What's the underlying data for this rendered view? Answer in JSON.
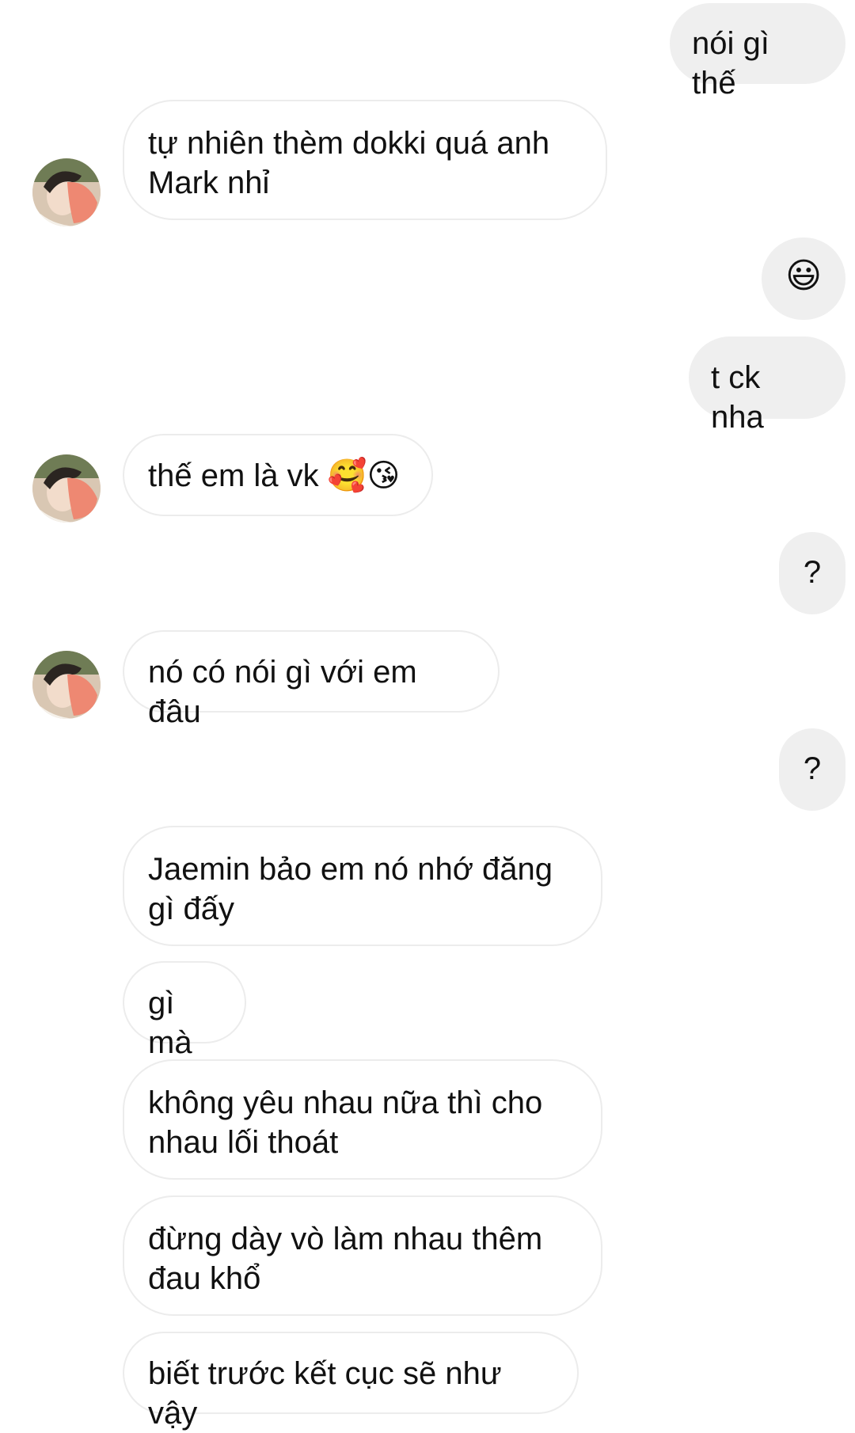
{
  "conversation": {
    "messages": [
      {
        "id": "m1",
        "sender": "me",
        "text": "nói gì thế"
      },
      {
        "id": "m2",
        "sender": "them",
        "text": "tự nhiên thèm dokki quá anh Mark nhỉ",
        "avatar": "contact-avatar"
      },
      {
        "id": "m3",
        "sender": "me",
        "text": "😃"
      },
      {
        "id": "m4",
        "sender": "me",
        "text": "t ck nha"
      },
      {
        "id": "m5",
        "sender": "them",
        "text": "thế em là vk 🥰😘",
        "avatar": "contact-avatar"
      },
      {
        "id": "m6",
        "sender": "me",
        "text": "?"
      },
      {
        "id": "m7",
        "sender": "them",
        "text": "nó có nói gì với em đâu",
        "avatar": "contact-avatar"
      },
      {
        "id": "m8",
        "sender": "me",
        "text": "?"
      },
      {
        "id": "m9",
        "sender": "them",
        "text": "Jaemin bảo em nó nhớ đăng gì đấy"
      },
      {
        "id": "m10",
        "sender": "them",
        "text": "gì mà"
      },
      {
        "id": "m11",
        "sender": "them",
        "text": "không yêu nhau nữa thì cho nhau lối thoát"
      },
      {
        "id": "m12",
        "sender": "them",
        "text": "đừng dày vò làm nhau thêm đau khổ"
      },
      {
        "id": "m13",
        "sender": "them",
        "text": "biết trước kết cục sẽ như vậy"
      }
    ]
  },
  "colors": {
    "outgoing_bubble": "#efefef",
    "incoming_border": "#ececec",
    "background": "#ffffff",
    "text": "#111111"
  }
}
